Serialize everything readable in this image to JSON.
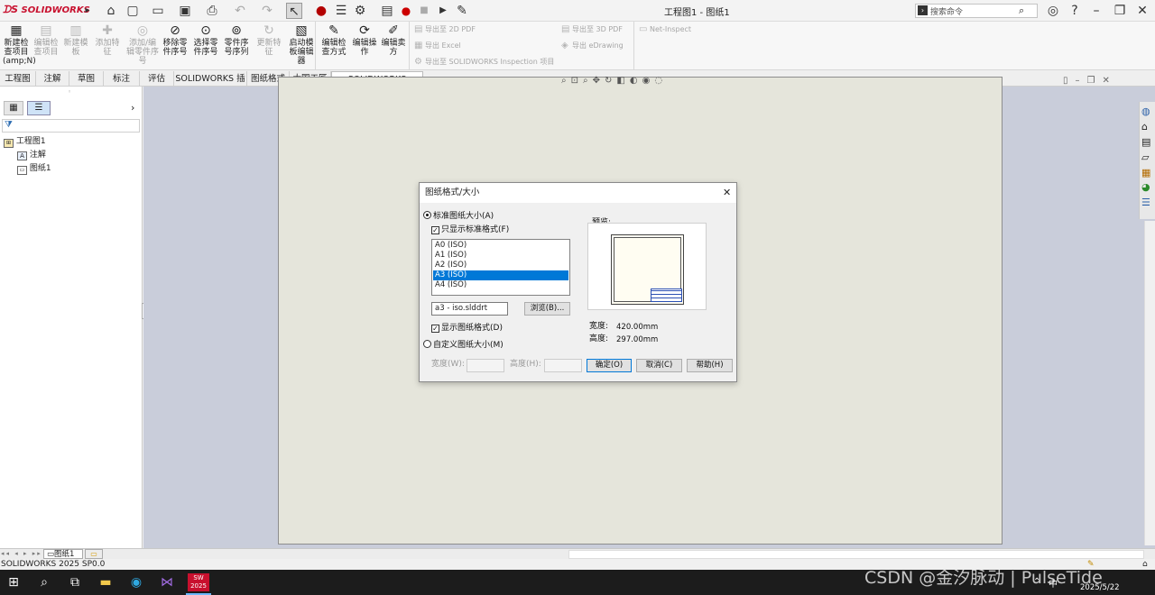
{
  "titlebar": {
    "app_name": "SOLIDWORKS",
    "document_title": "工程图1 - 图纸1",
    "search_placeholder": "搜索命令"
  },
  "ribbon": {
    "buttons": [
      {
        "label": "新建检查项目",
        "sub": "(amp;N)",
        "enabled": true,
        "icon": "new-inspection-icon"
      },
      {
        "label": "编辑检查项目",
        "enabled": false,
        "icon": "edit-inspection-icon"
      },
      {
        "label": "新建模板",
        "enabled": false,
        "icon": "new-template-icon"
      },
      {
        "label": "添加特征",
        "enabled": false,
        "icon": "add-feature-icon"
      },
      {
        "label": "添加/编辑零件序号",
        "enabled": false,
        "icon": "balloon-icon"
      },
      {
        "label": "移除零件序号",
        "enabled": true,
        "icon": "remove-balloon-icon"
      },
      {
        "label": "选择零件序号",
        "enabled": true,
        "icon": "select-balloon-icon"
      },
      {
        "label": "零件序号序列",
        "enabled": true,
        "icon": "balloon-sequence-icon"
      },
      {
        "label": "更新特征",
        "enabled": false,
        "icon": "update-feature-icon"
      },
      {
        "label": "启动模板编辑器",
        "enabled": true,
        "icon": "template-editor-icon"
      },
      {
        "label": "编辑检查方式",
        "enabled": true,
        "icon": "edit-method-icon"
      },
      {
        "label": "编辑操作",
        "enabled": true,
        "icon": "edit-operation-icon"
      },
      {
        "label": "编辑卖方",
        "enabled": true,
        "icon": "edit-vendor-icon"
      }
    ],
    "export": [
      "导出至 2D PDF",
      "导出至 3D PDF",
      "导出 Excel",
      "导出 eDrawing",
      "导出至 SOLIDWORKS Inspection 项目",
      "Net-Inspect"
    ]
  },
  "tabs": [
    "工程图",
    "注解",
    "草图",
    "标注",
    "评估",
    "SOLIDWORKS 插件",
    "图纸格式",
    "大国工匠",
    "SOLIDWORKS Inspection"
  ],
  "active_tab": "SOLIDWORKS Inspection",
  "tree": {
    "root": "工程图1",
    "children": [
      "注解",
      "图纸1"
    ]
  },
  "sheet_tab": "图纸1",
  "status_text": "SOLIDWORKS 2025 SP0.0",
  "taskbar": {
    "date": "2025/5/22",
    "app_label": "2025"
  },
  "dialog": {
    "title": "图纸格式/大小",
    "standard_size_label": "标准图纸大小(A)",
    "standard_selected": true,
    "only_show_standard_label": "只显示标准格式(F)",
    "only_show_standard_checked": true,
    "sizes": [
      "A0 (ISO)",
      "A1 (ISO)",
      "A2 (ISO)",
      "A3 (ISO)",
      "A4 (ISO)"
    ],
    "selected_size_index": 3,
    "format_file": "a3 - iso.slddrt",
    "browse_label": "浏览(B)...",
    "show_format_label": "显示图纸格式(D)",
    "show_format_checked": true,
    "custom_size_label": "自定义图纸大小(M)",
    "custom_selected": false,
    "width_label": "宽度(W):",
    "height_label": "高度(H):",
    "preview_label": "预览:",
    "width_caption": "宽度:",
    "width_value": "420.00mm",
    "height_caption": "高度:",
    "height_value": "297.00mm",
    "ok_label": "确定(O)",
    "cancel_label": "取消(C)",
    "help_label": "帮助(H)"
  },
  "watermark": "CSDN @金汐脉动 | PulseTide",
  "colors": {
    "accent": "#0078d7",
    "brand_red": "#d0021b",
    "sheet": "#e5e5db",
    "canvas": "#c9cdda"
  }
}
